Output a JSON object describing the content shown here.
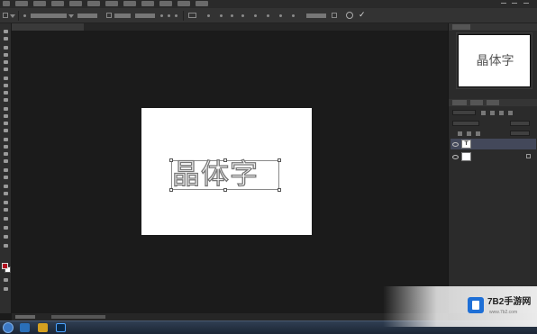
{
  "canvas": {
    "text": "晶体字",
    "background_color": "#ffffff"
  },
  "navigator": {
    "preview_text": "晶体字"
  },
  "layers_panel": {
    "layers": [
      {
        "thumbnail_label": "T",
        "selected": true
      },
      {
        "thumbnail_label": "",
        "selected": false
      }
    ]
  },
  "tools": {
    "foreground_color": "#b01020",
    "background_color": "#ffffff"
  },
  "watermark": {
    "title": "7B2手游网",
    "url": "www.7b2.com"
  },
  "icons": {
    "commit": "checkmark-icon",
    "cancel": "cancel-icon",
    "visibility": "eye-icon",
    "lock": "lock-icon"
  }
}
